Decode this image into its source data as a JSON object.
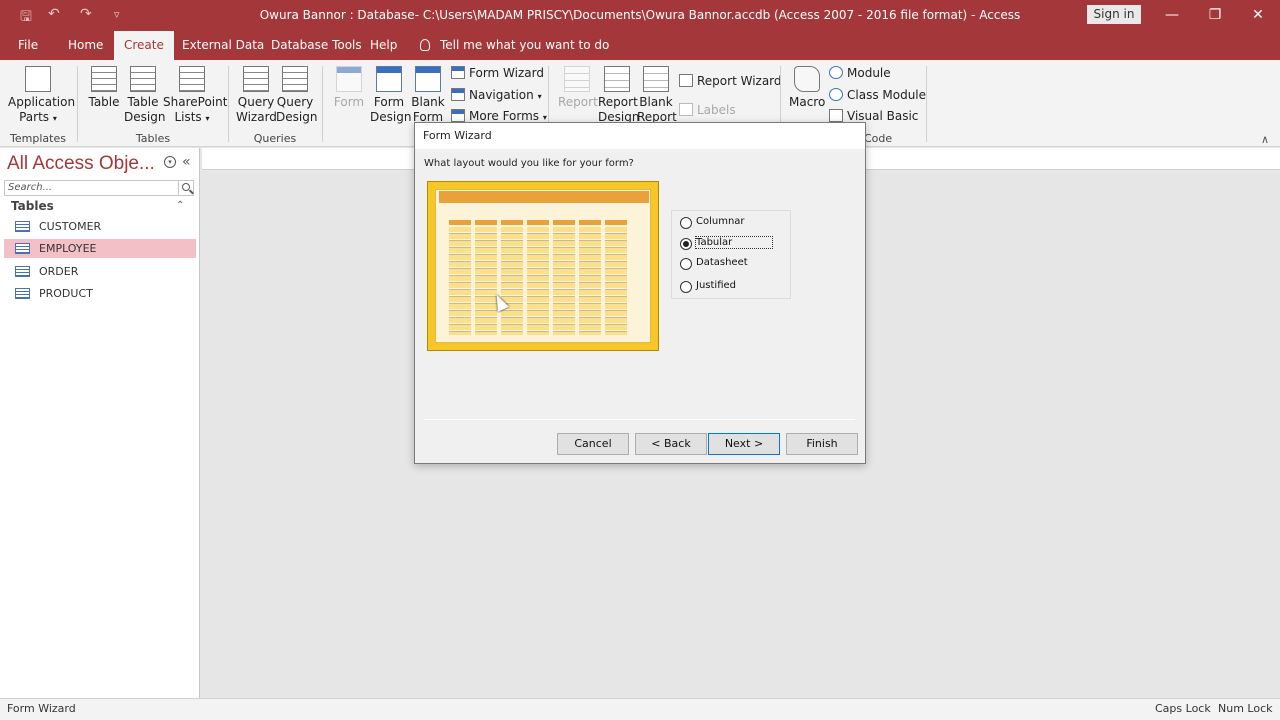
{
  "window": {
    "title": "Owura Bannor : Database- C:\\Users\\MADAM PRISCY\\Documents\\Owura Bannor.accdb (Access 2007 - 2016 file format)  -  Access",
    "sign_in": "Sign in"
  },
  "tabs": [
    "File",
    "Home",
    "Create",
    "External Data",
    "Database Tools",
    "Help"
  ],
  "tell_me": "Tell me what you want to do",
  "ribbon": {
    "templates": {
      "app_parts": "Application",
      "app_parts2": "Parts",
      "group": "Templates"
    },
    "tables": {
      "table": "Table",
      "table_design": "Table",
      "table_design2": "Design",
      "sharepoint": "SharePoint",
      "sharepoint2": "Lists",
      "group": "Tables"
    },
    "queries": {
      "query_wizard": "Query",
      "query_wizard2": "Wizard",
      "query_design": "Query",
      "query_design2": "Design",
      "group": "Queries"
    },
    "forms": {
      "form": "Form",
      "form_design": "Form",
      "form_design2": "Design",
      "blank_form": "Blank",
      "blank_form2": "Form",
      "form_wizard": "Form Wizard",
      "navigation": "Navigation",
      "more_forms": "More Forms"
    },
    "reports": {
      "report": "Report",
      "report_design": "Report",
      "report_design2": "Design",
      "blank_report": "Blank",
      "blank_report2": "Report",
      "report_wizard": "Report Wizard",
      "labels": "Labels"
    },
    "macros": {
      "macro": "Macro",
      "module": "Module",
      "class_module": "Class Module",
      "visual_basic": "Visual Basic",
      "group": "Code"
    }
  },
  "nav": {
    "title": "All Access Obje...",
    "search_placeholder": "Search...",
    "group": "Tables",
    "items": [
      "CUSTOMER",
      "EMPLOYEE",
      "ORDER",
      "PRODUCT"
    ]
  },
  "dialog": {
    "title": "Form Wizard",
    "question": "What layout would you like for your form?",
    "options": [
      "Columnar",
      "Tabular",
      "Datasheet",
      "Justified"
    ],
    "selected": "Tabular",
    "buttons": {
      "cancel": "Cancel",
      "back": "< Back",
      "next": "Next >",
      "finish": "Finish"
    }
  },
  "status": {
    "left": "Form Wizard",
    "caps": "Caps Lock",
    "num": "Num Lock"
  },
  "colors": {
    "accent": "#a4373a",
    "selected_item": "#f4c0c8",
    "preview_gold": "#f7c727"
  }
}
